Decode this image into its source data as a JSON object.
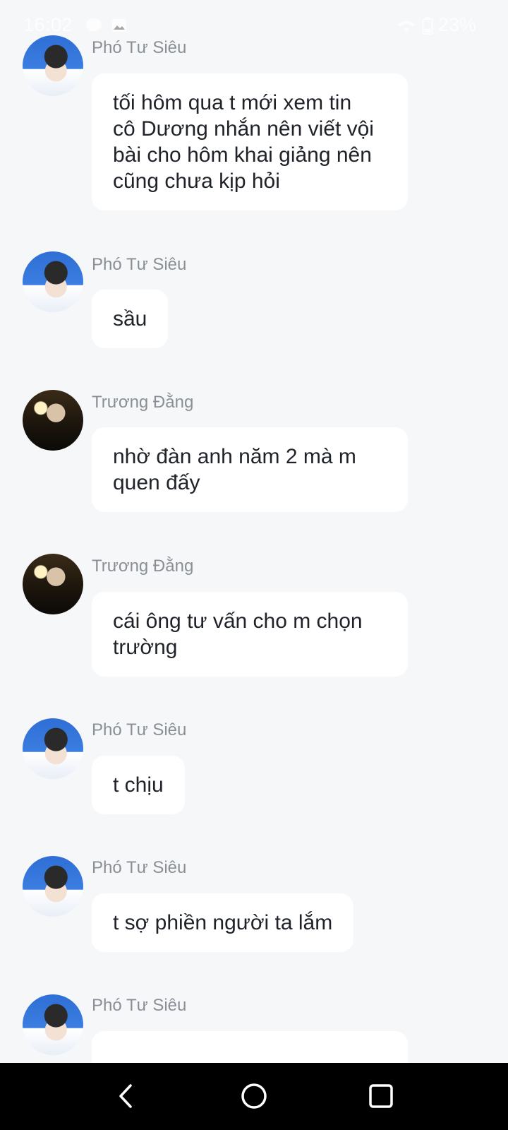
{
  "status_bar": {
    "time": "16:02",
    "battery": "23%",
    "icons": [
      "chat-notification-icon",
      "image-notification-icon",
      "wifi-icon",
      "battery-icon"
    ]
  },
  "messages": [
    {
      "sender": "Phó Tư Siêu",
      "avatar": "avatar-pho-tu-sieu",
      "lines": [
        "tối hôm qua t mới xem tin",
        "cô Dương nhắn nên viết vội",
        "bài cho hôm khai giảng nên",
        "cũng chưa kịp hỏi"
      ]
    },
    {
      "sender": "Phó Tư Siêu",
      "avatar": "avatar-pho-tu-sieu",
      "lines": [
        "sầu"
      ]
    },
    {
      "sender": "Trương Đằng",
      "avatar": "avatar-truong-dang",
      "lines": [
        "nhờ đàn anh năm 2 mà m",
        "quen đấy"
      ]
    },
    {
      "sender": "Trương Đằng",
      "avatar": "avatar-truong-dang",
      "lines": [
        "cái ông tư vấn cho m chọn",
        "trường"
      ]
    },
    {
      "sender": "Phó Tư Siêu",
      "avatar": "avatar-pho-tu-sieu",
      "lines": [
        "t chịu"
      ]
    },
    {
      "sender": "Phó Tư Siêu",
      "avatar": "avatar-pho-tu-sieu",
      "lines": [
        "t sợ phiền người ta lắm"
      ]
    },
    {
      "sender": "Phó Tư Siêu",
      "avatar": "avatar-pho-tu-sieu",
      "lines": [
        ""
      ]
    }
  ],
  "nav_bar": {
    "buttons": [
      "back-icon",
      "home-icon",
      "recents-icon"
    ]
  },
  "colors": {
    "background": "#f5f7f9",
    "bubble": "#ffffff",
    "sender_name": "#8a8f96",
    "message_text": "#1f2329",
    "nav_bar": "#000000"
  }
}
